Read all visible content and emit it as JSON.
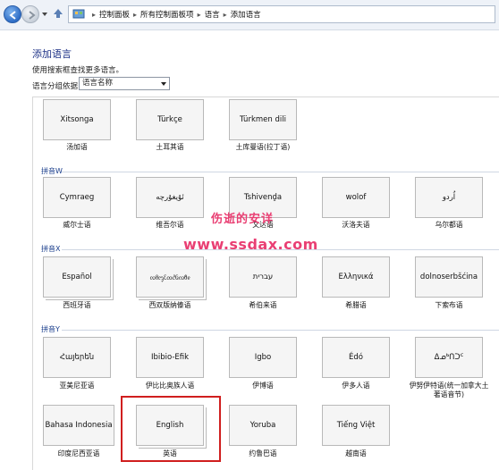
{
  "breadcrumb": {
    "items": [
      "控制面板",
      "所有控制面板项",
      "语言",
      "添加语言"
    ],
    "separator": "▸"
  },
  "page": {
    "title": "添加语言",
    "description": "使用搜索框查找更多语言。",
    "group_by_label": "语言分组依据:",
    "group_by_value": "语言名称"
  },
  "sections": {
    "w": "拼音W",
    "x": "拼音X",
    "y": "拼音Y"
  },
  "rows": {
    "row0": [
      {
        "name": "Xitsonga",
        "caption": "汤加语"
      },
      {
        "name": "Türkçe",
        "caption": "土耳其语"
      },
      {
        "name": "Türkmen dili",
        "caption": "土库曼语(拉丁语)"
      }
    ],
    "row_w": [
      {
        "name": "Cymraeg",
        "caption": "威尔士语"
      },
      {
        "name": "ئۇيغۇرچە",
        "caption": "维吾尔语"
      },
      {
        "name": "Tshivenḓa",
        "caption": "文达语"
      },
      {
        "name": "wolof",
        "caption": "沃洛夫语"
      },
      {
        "name": "اُردو",
        "caption": "乌尔都语"
      }
    ],
    "row_x": [
      {
        "name": "Español",
        "caption": "西班牙语"
      },
      {
        "name": "ᦟᦲᧅᦷᦎᦺᦑᦟᦹᧉ",
        "caption": "西双版纳傣语"
      },
      {
        "name": "עברית",
        "caption": "希伯来语"
      },
      {
        "name": "Ελληνικά",
        "caption": "希腊语"
      },
      {
        "name": "dolnoserbšćina",
        "caption": "下索布语"
      }
    ],
    "row_y": [
      {
        "name": "Հայերեն",
        "caption": "亚美尼亚语"
      },
      {
        "name": "Ibibio-Efik",
        "caption": "伊比比奥族人语"
      },
      {
        "name": "Igbo",
        "caption": "伊博语"
      },
      {
        "name": "Édó",
        "caption": "伊多人语"
      },
      {
        "name": "ᐃᓄᒃᑎᑐᑦ",
        "caption": "伊努伊特语(统一加拿大土著语音节)"
      }
    ],
    "row_y2": [
      {
        "name": "Bahasa Indonesia",
        "caption": "印度尼西亚语"
      },
      {
        "name": "English",
        "caption": "英语"
      },
      {
        "name": "Yoruba",
        "caption": "约鲁巴语"
      },
      {
        "name": "Tiếng Việt",
        "caption": "越南语"
      }
    ]
  },
  "watermark": {
    "line1": "伤逝的安详",
    "line2": "www.ssdax.com"
  },
  "colors": {
    "title": "#1e3287",
    "highlight": "#d01e1e",
    "watermark": "#e93f73"
  }
}
